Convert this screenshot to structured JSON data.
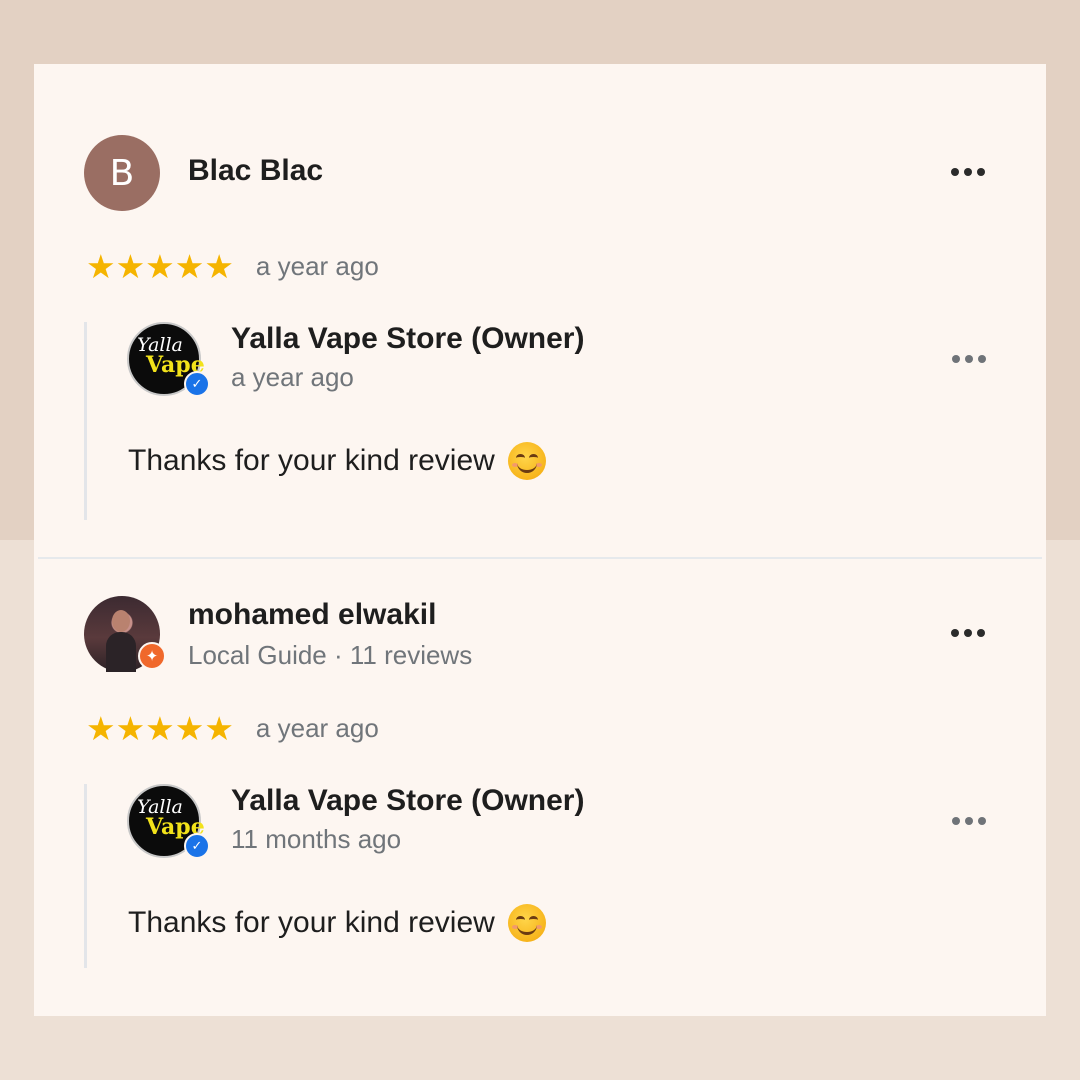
{
  "reviews": [
    {
      "reviewer": {
        "avatar_letter": "B",
        "avatar_color": "#9a6e63",
        "name": "Blac Blac",
        "subtitle": ""
      },
      "rating": 5,
      "stars": "★★★★★",
      "time": "a year ago",
      "owner_reply": {
        "name": "Yalla Vape Store (Owner)",
        "time": "a year ago",
        "text": "Thanks for your kind review",
        "logo_text": {
          "line1": "Yalla",
          "line2": "Vape"
        }
      }
    },
    {
      "reviewer": {
        "name": "mohamed elwakil",
        "subtitle": "Local Guide · 11 reviews",
        "badge_icon": "local-guide-badge-icon"
      },
      "rating": 5,
      "stars": "★★★★★",
      "time": "a year ago",
      "owner_reply": {
        "name": "Yalla Vape Store (Owner)",
        "time": "11 months ago",
        "text": "Thanks for your kind review",
        "logo_text": {
          "line1": "Yalla",
          "line2": "Vape"
        }
      }
    }
  ],
  "icons": {
    "more": "more-options-icon",
    "verified": "verified-check-icon",
    "emoji": "smiling-face-emoji-icon"
  },
  "colors": {
    "star": "#f5b400",
    "secondary_text": "#70757a",
    "verified": "#1a73e8",
    "local_guide": "#f0682b"
  }
}
